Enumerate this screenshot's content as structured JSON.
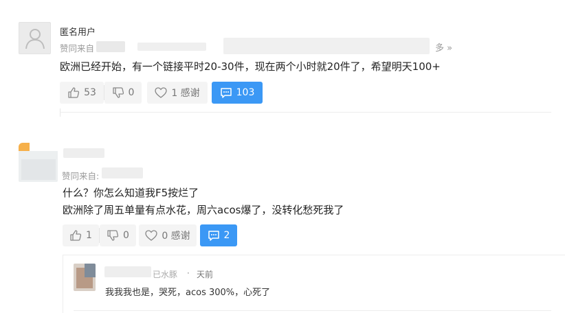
{
  "comment1": {
    "username": "匿名用户",
    "meta_prefix": "赞同来自",
    "more_link": "多 »",
    "content": "欧洲已经开始，有一个链接平时20-30件，现在两个小时就20件了，希望明天100+",
    "likes": "53",
    "dislikes": "0",
    "thanks": "1 感谢",
    "comments": "103"
  },
  "comment2": {
    "meta_prefix": "赞同来自:",
    "line1": "什么？你怎么知道我F5按烂了",
    "line2": "欧洲除了周五单量有点水花，周六acos爆了，没转化愁死我了",
    "likes": "1",
    "dislikes": "0",
    "thanks": "0 感谢",
    "comments": "2"
  },
  "reply": {
    "name_suffix": "已水豚",
    "time": "天前",
    "content": "我我我也是，哭死，acos 300%，心死了"
  },
  "colors": {
    "accent": "#3b98f5",
    "muted": "#9a9a9a"
  }
}
